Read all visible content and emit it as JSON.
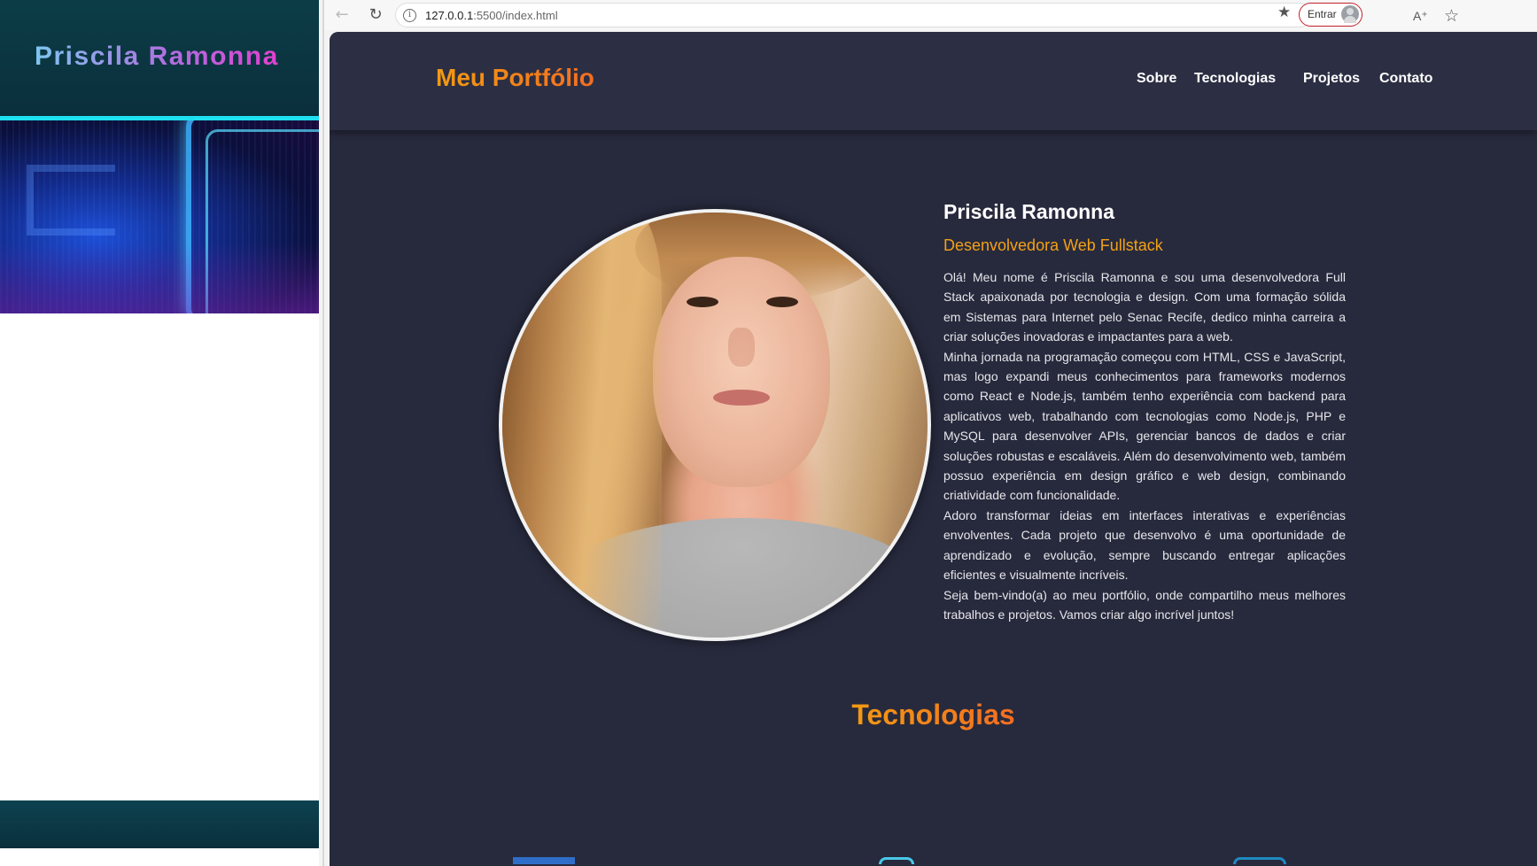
{
  "left_pane": {
    "title": "Priscila Ramonna"
  },
  "browser": {
    "url_host": "127.0.0.1",
    "url_rest": ":5500/index.html",
    "signin_label": "Entrar"
  },
  "site": {
    "brand": "Meu Portfólio",
    "nav": [
      "Sobre",
      "Tecnologias",
      "Projetos",
      "Contato"
    ],
    "profile": {
      "name": "Priscila Ramonna",
      "role": "Desenvolvedora Web Fullstack",
      "paragraphs": [
        "Olá! Meu nome é Priscila Ramonna e sou uma desenvolvedora Full Stack apaixonada por tecnologia e design. Com uma formação sólida em Sistemas para Internet pelo Senac Recife, dedico minha carreira a criar soluções inovadoras e impactantes para a web.",
        "Minha jornada na programação começou com HTML, CSS e JavaScript, mas logo expandi meus conhecimentos para frameworks modernos como React e Node.js, também tenho experiência com backend para aplicativos web, trabalhando com tecnologias como Node.js, PHP e MySQL para desenvolver APIs, gerenciar bancos de dados e criar soluções robustas e escaláveis. Além do desenvolvimento web, também possuo experiência em design gráfico e web design, combinando criatividade com funcionalidade.",
        "Adoro transformar ideias em interfaces interativas e experiências envolventes. Cada projeto que desenvolvo é uma oportunidade de aprendizado e evolução, sempre buscando entregar aplicações eficientes e visualmente incríveis.",
        "Seja bem-vindo(a) ao meu portfólio, onde compartilho meus melhores trabalhos e projetos. Vamos criar algo incrível juntos!"
      ]
    },
    "section_title": "Tecnologias",
    "colors": {
      "accent_orange": "#f3861a",
      "background": "#272a3d",
      "header": "#2c2f43"
    }
  }
}
